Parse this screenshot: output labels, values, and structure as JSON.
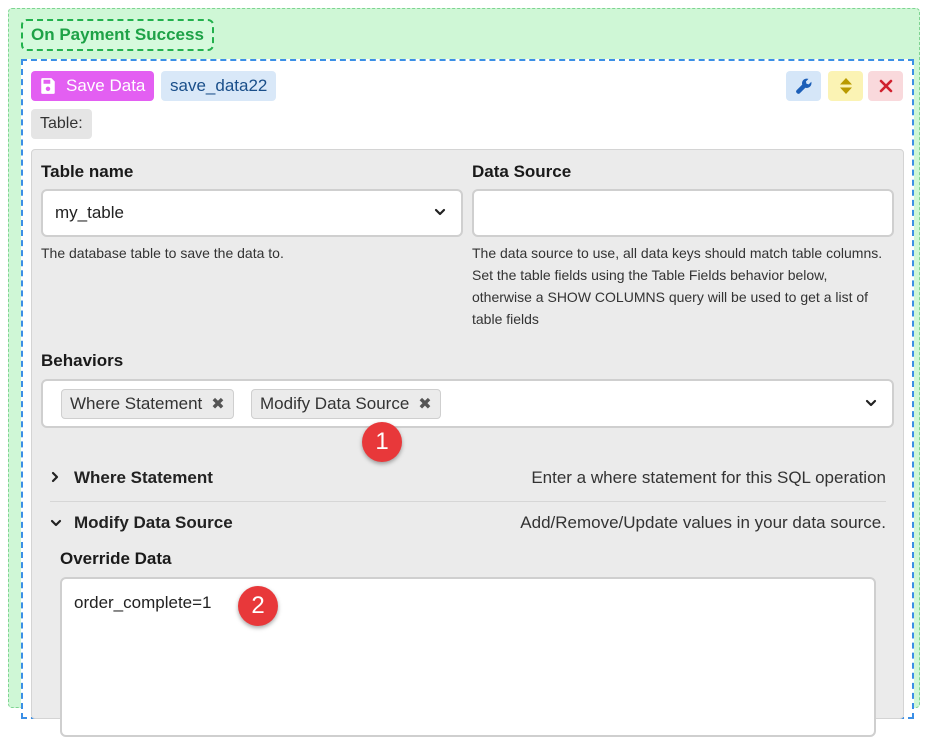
{
  "event": {
    "label": "On Payment Success"
  },
  "action": {
    "type_label": "Save Data",
    "name": "save_data22",
    "icon": "floppy-disk-icon",
    "colors": {
      "badge": "#e35ff2",
      "name_bg": "#d9e8f8"
    }
  },
  "toolbar": {
    "settings_icon": "wrench-icon",
    "move_icon": "sort-arrows-icon",
    "delete_icon": "close-icon"
  },
  "section": {
    "label": "Table:"
  },
  "fields": {
    "table_name": {
      "title": "Table name",
      "value": "my_table",
      "help": "The database table to save the data to."
    },
    "data_source": {
      "title": "Data Source",
      "value": "",
      "help_lines": [
        "The data source to use, all data keys should match table columns.",
        "Set the table fields using the Table Fields behavior below,",
        "otherwise a SHOW COLUMNS query will be used to get a list of",
        "table fields"
      ]
    },
    "behaviors": {
      "title": "Behaviors",
      "tags": [
        "Where Statement",
        "Modify Data Source"
      ],
      "remove_glyph": "✖"
    }
  },
  "accordion": [
    {
      "name": "Where Statement",
      "description": "Enter a where statement for this SQL operation",
      "expanded": false,
      "caret": "›"
    },
    {
      "name": "Modify Data Source",
      "description": "Add/Remove/Update values in your data source.",
      "expanded": true,
      "caret": "⌄"
    }
  ],
  "override": {
    "title": "Override Data",
    "value": "order_complete=1"
  },
  "markers": [
    "1",
    "2"
  ]
}
